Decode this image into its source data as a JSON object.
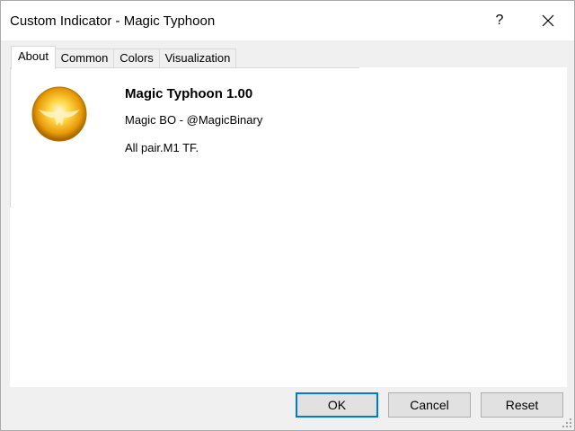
{
  "window": {
    "title": "Custom Indicator - Magic Typhoon",
    "help_label": "?"
  },
  "tabs": [
    {
      "label": "About",
      "active": true
    },
    {
      "label": "Common",
      "active": false
    },
    {
      "label": "Colors",
      "active": false
    },
    {
      "label": "Visualization",
      "active": false
    }
  ],
  "about": {
    "name": "Magic Typhoon 1.00",
    "author": "Magic BO - @MagicBinary",
    "description": "All pair.M1 TF.",
    "logo_icon": "golden-bird-logo"
  },
  "buttons": {
    "ok": "OK",
    "cancel": "Cancel",
    "reset": "Reset"
  },
  "colors": {
    "accent": "#0078d7",
    "logo_gold": "#f2b705"
  }
}
